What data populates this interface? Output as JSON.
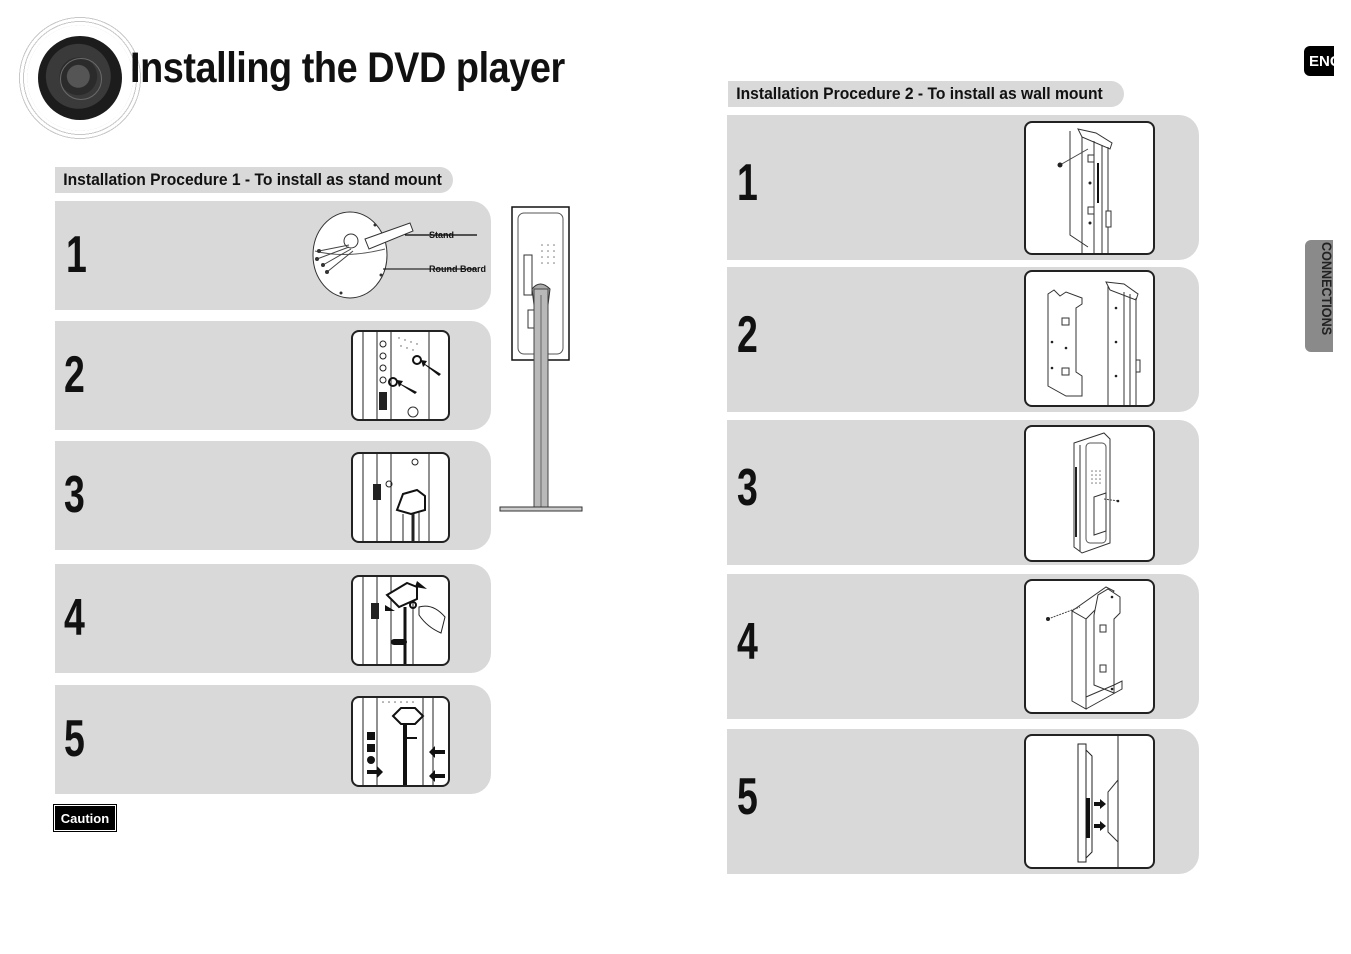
{
  "page": {
    "title": "Installing the DVD player",
    "language_tab": "ENG",
    "section_tab": "CONNECTIONS"
  },
  "procedure1": {
    "heading": "Installation Procedure 1 - To install as stand mount",
    "steps": [
      {
        "number": "1",
        "callouts": [
          "Stand",
          "Round Board"
        ]
      },
      {
        "number": "2"
      },
      {
        "number": "3"
      },
      {
        "number": "4"
      },
      {
        "number": "5"
      }
    ],
    "caution_label": "Caution"
  },
  "procedure2": {
    "heading": "Installation Procedure 2 - To install as wall mount",
    "steps": [
      {
        "number": "1"
      },
      {
        "number": "2"
      },
      {
        "number": "3"
      },
      {
        "number": "4"
      },
      {
        "number": "5"
      }
    ]
  },
  "colors": {
    "panel": "#d9d9d9",
    "tab_gray": "#8a8a8a",
    "ink": "#111111"
  }
}
